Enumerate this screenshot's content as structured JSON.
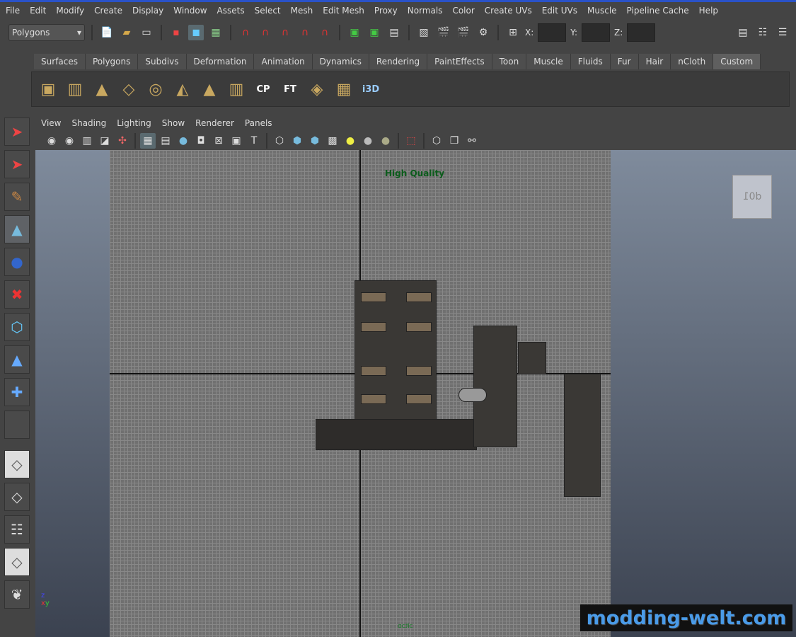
{
  "menu": [
    "File",
    "Edit",
    "Modify",
    "Create",
    "Display",
    "Window",
    "Assets",
    "Select",
    "Mesh",
    "Edit Mesh",
    "Proxy",
    "Normals",
    "Color",
    "Create UVs",
    "Edit UVs",
    "Muscle",
    "Pipeline Cache",
    "Help"
  ],
  "status": {
    "mode": "Polygons",
    "x_label": "X:",
    "y_label": "Y:",
    "z_label": "Z:"
  },
  "shelf_tabs": [
    "Surfaces",
    "Polygons",
    "Subdivs",
    "Deformation",
    "Animation",
    "Dynamics",
    "Rendering",
    "PaintEffects",
    "Toon",
    "Muscle",
    "Fluids",
    "Fur",
    "Hair",
    "nCloth",
    "Custom"
  ],
  "active_shelf_tab": "Custom",
  "shelf_icons": [
    {
      "name": "cube-icon",
      "glyph": "▣"
    },
    {
      "name": "cylinder-icon",
      "glyph": "▥"
    },
    {
      "name": "cone-icon",
      "glyph": "▲"
    },
    {
      "name": "plane-icon",
      "glyph": "◇"
    },
    {
      "name": "torus-icon",
      "glyph": "◎"
    },
    {
      "name": "prism-icon",
      "glyph": "◭"
    },
    {
      "name": "pyramid-icon",
      "glyph": "▲"
    },
    {
      "name": "pipe-icon",
      "glyph": "▥"
    },
    {
      "name": "cp-icon",
      "label": "CP"
    },
    {
      "name": "ft-icon",
      "label": "FT"
    },
    {
      "name": "uv-icon",
      "glyph": "◈"
    },
    {
      "name": "uv-grid-icon",
      "glyph": "▦"
    },
    {
      "name": "i3d-icon",
      "label": "i3D"
    }
  ],
  "panel_menu": [
    "View",
    "Shading",
    "Lighting",
    "Show",
    "Renderer",
    "Panels"
  ],
  "viewport": {
    "hud_text": "High Quality",
    "view_cube_label": "d01",
    "hud_color": "#0b5c1b"
  },
  "watermark": "modding-welt.com"
}
